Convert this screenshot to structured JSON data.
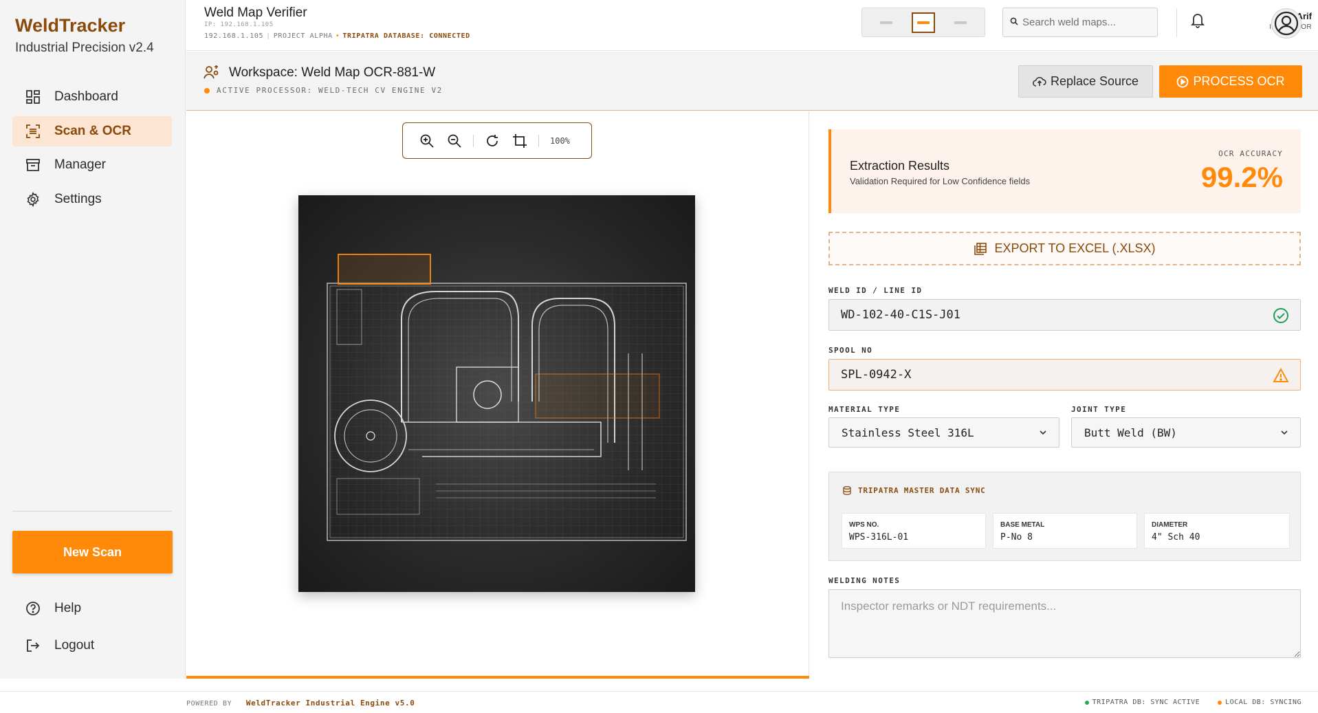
{
  "brand": {
    "title": "WeldTracker",
    "subtitle": "Industrial Precision v2.4"
  },
  "sidebar": {
    "items": [
      {
        "label": "Dashboard",
        "icon": "dashboard-icon",
        "active": false
      },
      {
        "label": "Scan & OCR",
        "icon": "scan-icon",
        "active": true
      },
      {
        "label": "Manager",
        "icon": "archive-icon",
        "active": false
      },
      {
        "label": "Settings",
        "icon": "gear-icon",
        "active": false
      }
    ],
    "new_scan_label": "New Scan",
    "help_label": "Help",
    "logout_label": "Logout"
  },
  "topbar": {
    "title": "Weld Map Verifier",
    "ip_line": "IP: 192.168.1.105",
    "ip": "192.168.1.105",
    "project": "PROJECT ALPHA",
    "db_status": "TRIPATRA DATABASE: CONNECTED",
    "search_placeholder": "Search weld maps...",
    "user_name": "Arif",
    "user_role": "INSPECTOR"
  },
  "workspace": {
    "title": "Workspace: Weld Map OCR-881-W",
    "processor": "ACTIVE PROCESSOR: WELD-TECH CV ENGINE V2",
    "replace_label": "Replace Source",
    "process_label": "PROCESS OCR"
  },
  "viewer": {
    "zoom_label": "100%"
  },
  "results": {
    "title": "Extraction Results",
    "subtitle": "Validation Required for Low Confidence fields",
    "accuracy_label": "OCR ACCURACY",
    "accuracy_value": "99.2%",
    "export_label": "EXPORT TO EXCEL (.XLSX)"
  },
  "form": {
    "weld_id_label": "WELD ID / LINE ID",
    "weld_id_value": "WD-102-40-C1S-J01",
    "spool_label": "SPOOL NO",
    "spool_value": "SPL-0942-X",
    "material_label": "MATERIAL TYPE",
    "material_value": "Stainless Steel 316L",
    "joint_label": "JOINT TYPE",
    "joint_value": "Butt Weld (BW)",
    "notes_label": "WELDING NOTES",
    "notes_placeholder": "Inspector remarks or NDT requirements..."
  },
  "sync": {
    "title": "TRIPATRA MASTER DATA SYNC",
    "cells": [
      {
        "label": "WPS NO.",
        "value": "WPS-316L-01"
      },
      {
        "label": "BASE METAL",
        "value": "P-No 8"
      },
      {
        "label": "DIAMETER",
        "value": "4\" Sch 40"
      }
    ]
  },
  "footer": {
    "powered_by": "POWERED BY",
    "engine": "WeldTracker Industrial Engine v5.0",
    "tripatra_status": "TRIPATRA DB: SYNC ACTIVE",
    "local_status": "LOCAL DB: SYNCING"
  },
  "colors": {
    "accent": "#ff8a0a",
    "brand": "#8a4a0c",
    "ok": "#1e9e57",
    "sync_ok": "#22aa55"
  }
}
